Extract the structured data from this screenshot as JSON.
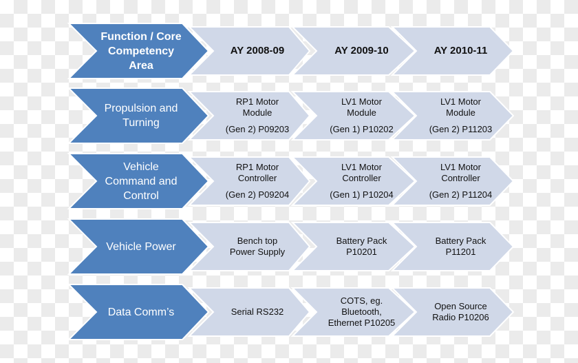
{
  "colors": {
    "header_fill": "#4f81bd",
    "cell_fill": "#d0d8e8",
    "header_text": "#ffffff",
    "cell_text": "#111111"
  },
  "rows": [
    {
      "id": "header",
      "header": [
        "Function / Core",
        "Competency",
        "Area"
      ],
      "header_bold": true,
      "cells_bold": true,
      "cells": [
        {
          "lines": [
            "AY 2008-09"
          ],
          "sub": []
        },
        {
          "lines": [
            "AY 2009-10"
          ],
          "sub": []
        },
        {
          "lines": [
            "AY 2010-11"
          ],
          "sub": []
        }
      ]
    },
    {
      "id": "propulsion-and-turning",
      "header": [
        "Propulsion and",
        "Turning"
      ],
      "header_bold": false,
      "cells_bold": false,
      "cells": [
        {
          "lines": [
            "RP1 Motor",
            "Module"
          ],
          "sub": [
            "(Gen 2) P09203"
          ]
        },
        {
          "lines": [
            "LV1 Motor",
            "Module"
          ],
          "sub": [
            "(Gen 1) P10202"
          ]
        },
        {
          "lines": [
            "LV1 Motor",
            "Module"
          ],
          "sub": [
            "(Gen 2) P11203"
          ]
        }
      ]
    },
    {
      "id": "vehicle-command-and-control",
      "header": [
        "Vehicle",
        "Command and",
        "Control"
      ],
      "header_bold": false,
      "cells_bold": false,
      "cells": [
        {
          "lines": [
            "RP1 Motor",
            "Controller"
          ],
          "sub": [
            "(Gen 2)  P09204"
          ]
        },
        {
          "lines": [
            "LV1 Motor",
            "Controller"
          ],
          "sub": [
            "(Gen 1)  P10204"
          ]
        },
        {
          "lines": [
            "LV1 Motor",
            "Controller"
          ],
          "sub": [
            "(Gen 2) P11204"
          ]
        }
      ]
    },
    {
      "id": "vehicle-power",
      "header": [
        "Vehicle Power"
      ],
      "header_bold": false,
      "cells_bold": false,
      "cells": [
        {
          "lines": [
            "Bench top",
            "Power Supply"
          ],
          "sub": []
        },
        {
          "lines": [
            "Battery Pack",
            "P10201"
          ],
          "sub": []
        },
        {
          "lines": [
            "Battery Pack",
            "P11201"
          ],
          "sub": []
        }
      ]
    },
    {
      "id": "data-comms",
      "header": [
        "Data Comm’s"
      ],
      "header_bold": false,
      "cells_bold": false,
      "cells": [
        {
          "lines": [
            "Serial RS232"
          ],
          "sub": []
        },
        {
          "lines": [
            "COTS, eg.",
            "Bluetooth,",
            "Ethernet P10205"
          ],
          "sub": []
        },
        {
          "lines": [
            "Open Source",
            "Radio P10206"
          ],
          "sub": []
        }
      ]
    }
  ]
}
